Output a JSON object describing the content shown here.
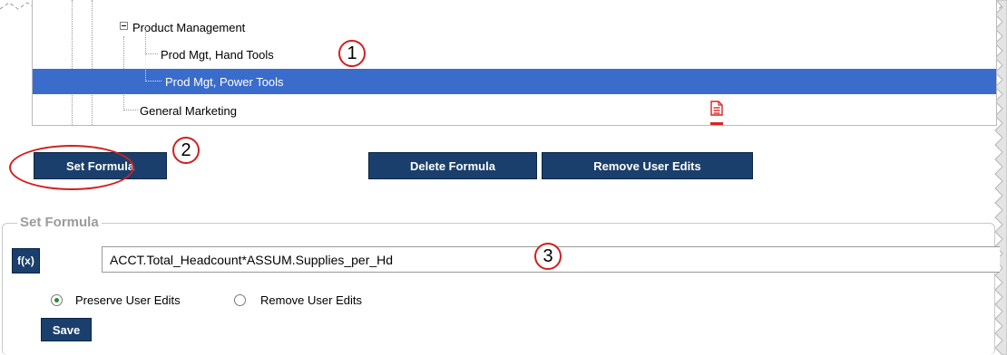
{
  "tree": {
    "items": [
      {
        "label": "Product Management",
        "expanded": true
      },
      {
        "label": "Prod Mgt, Hand Tools"
      },
      {
        "label": "Prod Mgt, Power Tools",
        "selected": true
      },
      {
        "label": "General Marketing"
      }
    ]
  },
  "callouts": [
    "1",
    "2",
    "3"
  ],
  "toolbar": {
    "set_formula": "Set Formula",
    "delete_formula": "Delete Formula",
    "remove_user_edits": "Remove User Edits"
  },
  "formula_panel": {
    "legend": "Set Formula",
    "fx_label": "f(x)",
    "formula_value": "ACCT.Total_Headcount*ASSUM.Supplies_per_Hd",
    "options": [
      {
        "label": "Preserve User Edits",
        "checked": true
      },
      {
        "label": "Remove User Edits",
        "checked": false
      }
    ],
    "save_label": "Save"
  },
  "colors": {
    "button_bg": "#1b3f6c",
    "selection": "#3a6ccb",
    "callout_red": "#d21f1f"
  }
}
